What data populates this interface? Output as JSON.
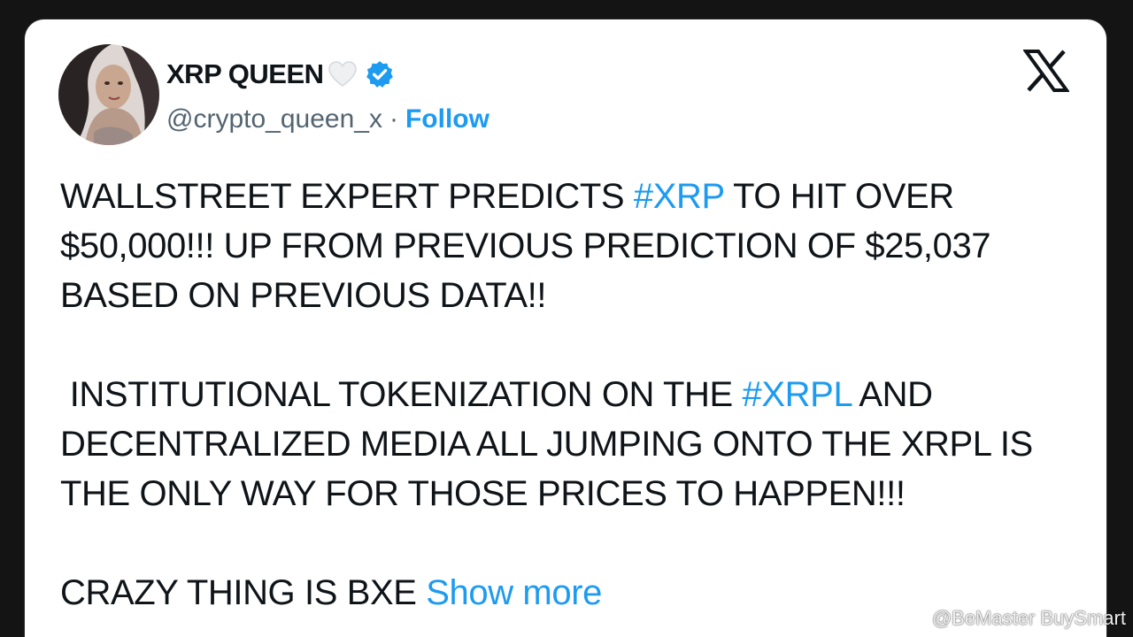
{
  "tweet": {
    "author": {
      "display_name": "XRP QUEEN",
      "heart_icon": "white-heart-icon",
      "verified_icon": "verified-badge-icon",
      "handle": "@crypto_queen_x",
      "separator": "·",
      "follow_label": "Follow"
    },
    "platform_logo": "x-logo-icon",
    "body": {
      "p1_a": "WALLSTREET EXPERT PREDICTS ",
      "p1_hashtag": "#XRP",
      "p1_b": " TO HIT OVER $50,000!!! UP FROM PREVIOUS PREDICTION OF $25,037 BASED ON PREVIOUS DATA!!",
      "p2_a": " INSTITUTIONAL TOKENIZATION ON THE ",
      "p2_hashtag": "#XRPL",
      "p2_b": " AND DECENTRALIZED MEDIA ALL JUMPING ONTO THE XRPL IS THE ONLY WAY FOR THOSE PRICES TO HAPPEN!!!",
      "p3_a": "CRAZY THING IS BXE ",
      "show_more": "Show more"
    }
  },
  "watermark": {
    "text": "@BeMaster BuySmart",
    "icon": "binance-logo-icon"
  },
  "colors": {
    "link_blue": "#1d9bf0",
    "text": "#0f1419",
    "muted": "#536471",
    "card": "#ffffff",
    "frame": "#141414"
  }
}
